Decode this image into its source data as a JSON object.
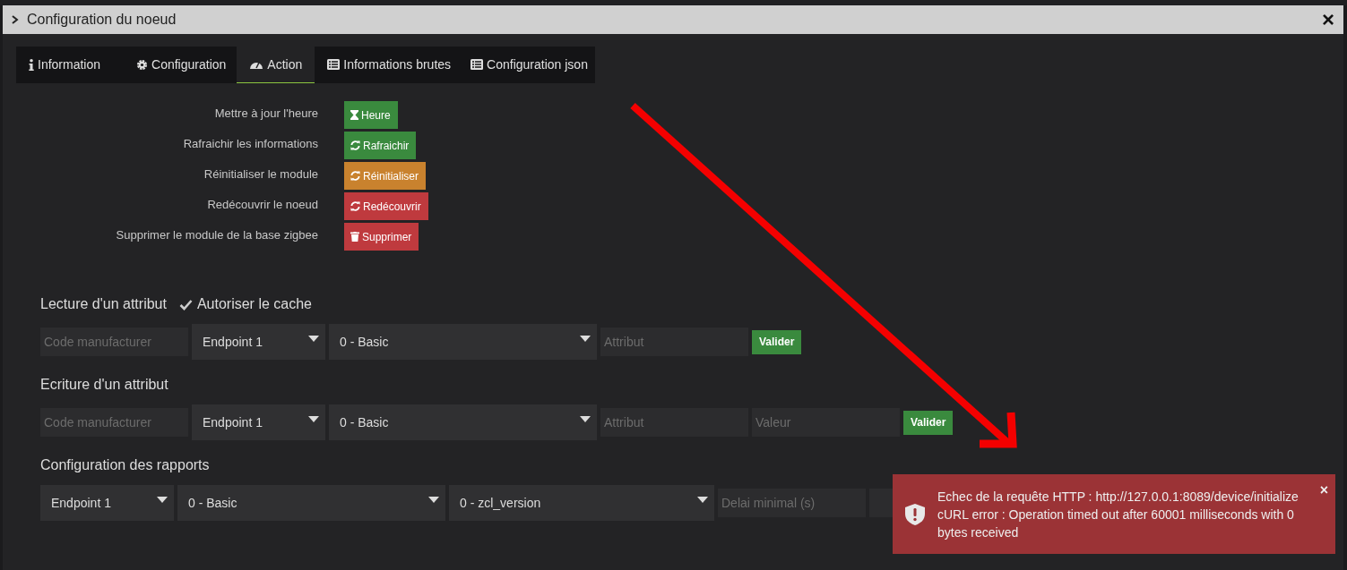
{
  "window": {
    "title": "Configuration du noeud",
    "close": "×"
  },
  "tabs": [
    {
      "label": "Information",
      "selected": false
    },
    {
      "label": "Configuration",
      "selected": false
    },
    {
      "label": "Action",
      "selected": true
    },
    {
      "label": "Informations brutes",
      "selected": false
    },
    {
      "label": "Configuration json",
      "selected": false
    }
  ],
  "actions": [
    {
      "label": "Mettre à jour l'heure",
      "button": "Heure",
      "color": "#3a8a3e"
    },
    {
      "label": "Rafraichir les informations",
      "button": "Rafraichir",
      "color": "#3a8a3e"
    },
    {
      "label": "Réinitialiser le module",
      "button": "Réinitialiser",
      "color": "#c9822e"
    },
    {
      "label": "Redécouvrir le noeud",
      "button": "Redécouvrir",
      "color": "#bf3a3e"
    },
    {
      "label": "Supprimer le module de la base zigbee",
      "button": "Supprimer",
      "color": "#bf3a3e"
    }
  ],
  "sections": [
    {
      "title": "Lecture d'un attribut",
      "option": {
        "label": "Autoriser le cache",
        "checked": true
      },
      "controls": [
        {
          "kind": "input",
          "placeholder": "Code manufacturer"
        },
        {
          "kind": "select",
          "value": "Endpoint 1"
        },
        {
          "kind": "select",
          "value": "0 - Basic"
        },
        {
          "kind": "input",
          "placeholder": "Attribut"
        },
        {
          "kind": "button",
          "label": "Valider"
        }
      ]
    },
    {
      "title": "Ecriture d'un attribut",
      "controls": [
        {
          "kind": "input",
          "placeholder": "Code manufacturer"
        },
        {
          "kind": "select",
          "value": "Endpoint 1"
        },
        {
          "kind": "select",
          "value": "0 - Basic"
        },
        {
          "kind": "input",
          "placeholder": "Attribut"
        },
        {
          "kind": "input",
          "placeholder": "Valeur"
        },
        {
          "kind": "button",
          "label": "Valider"
        }
      ]
    },
    {
      "title": "Configuration des rapports",
      "controls": [
        {
          "kind": "select",
          "value": "Endpoint 1"
        },
        {
          "kind": "select",
          "value": "0 - Basic"
        },
        {
          "kind": "select",
          "value": "0 - zcl_version"
        },
        {
          "kind": "input",
          "placeholder": "Delai minimal (s)"
        },
        {
          "kind": "input"
        }
      ]
    }
  ],
  "toast": {
    "lines": [
      "Echec de la requête HTTP : http://127.0.0.1:8089/device/initialize",
      "cURL error : Operation timed out after 60001 milliseconds with 0 bytes received"
    ],
    "close": "×"
  }
}
